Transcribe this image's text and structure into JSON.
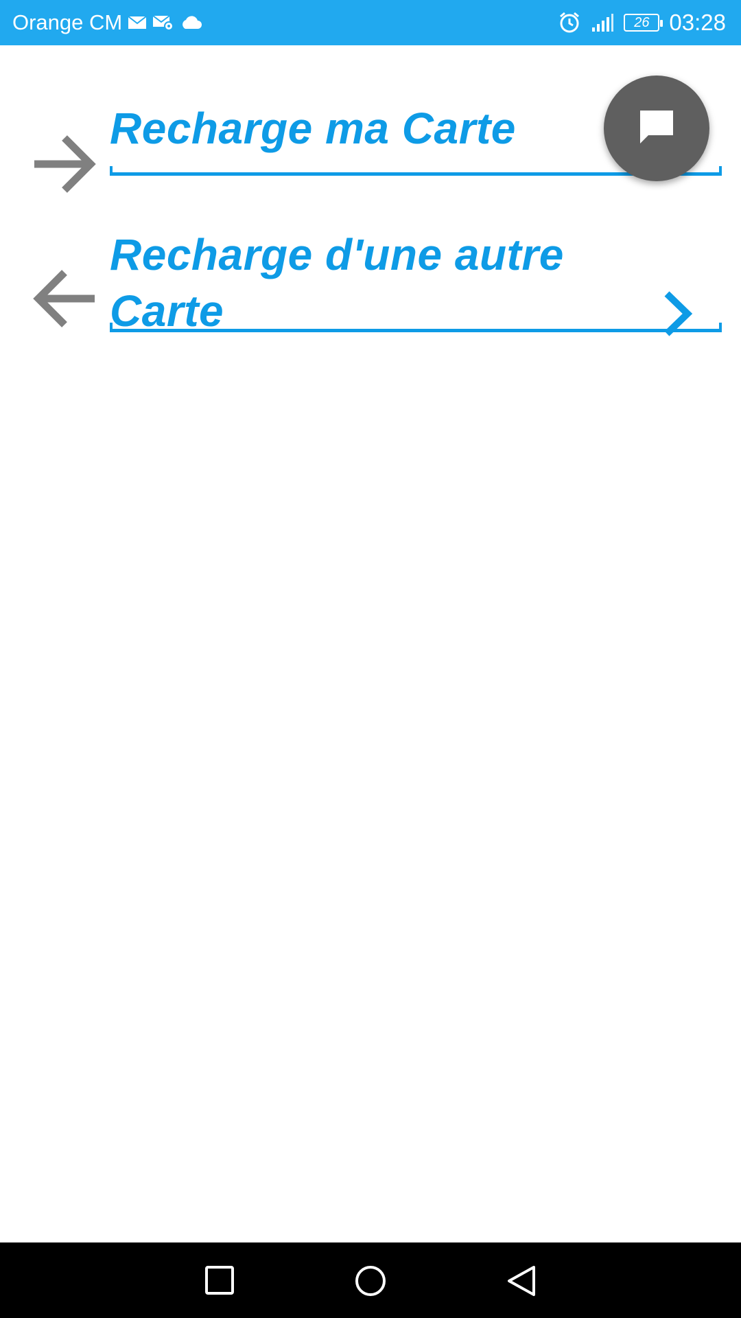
{
  "status_bar": {
    "carrier": "Orange CM",
    "battery_level": "26",
    "time": "03:28",
    "left_icons": [
      "mail-icon",
      "mail-settings-icon",
      "cloud-icon"
    ],
    "right_icons": [
      "alarm-icon",
      "signal-icon",
      "battery-icon"
    ]
  },
  "menu": {
    "items": [
      {
        "label": "Recharge ma Carte",
        "icon": "arrow-right-icon"
      },
      {
        "label_line1": "Recharge d'une autre",
        "label_line2": "Carte",
        "icon": "arrow-left-icon",
        "trailing_icon": "chevron-right-icon"
      }
    ]
  },
  "fab": {
    "icon": "chat-icon"
  },
  "nav_bar": {
    "buttons": [
      "recents-button",
      "home-button",
      "back-button"
    ]
  },
  "colors": {
    "status_bar": "#21a9ef",
    "accent": "#0e9be6",
    "icon_gray": "#808080",
    "fab": "#5f5f5f"
  }
}
